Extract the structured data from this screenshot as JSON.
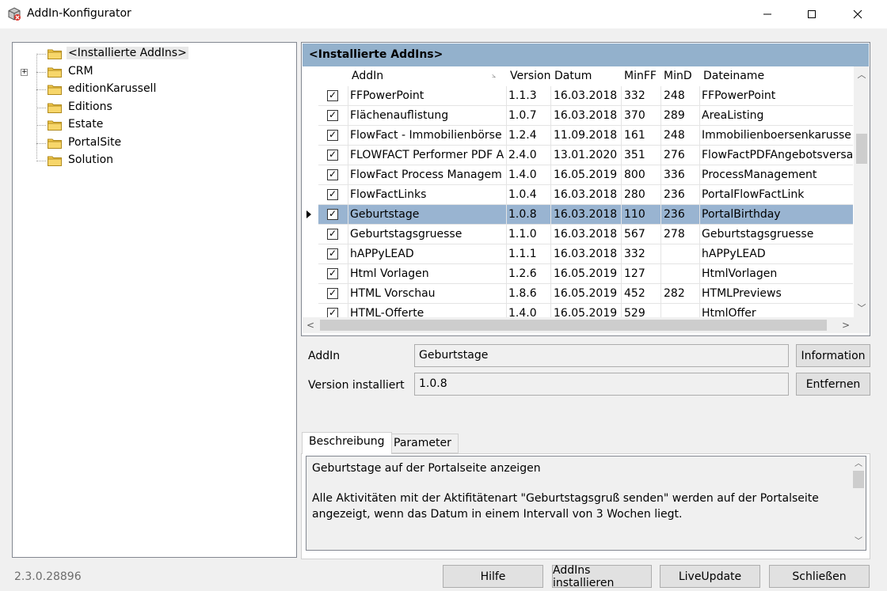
{
  "window": {
    "title": "AddIn-Konfigurator",
    "minimize_glyph": "—",
    "maximize_glyph": "☐",
    "close_glyph": "✕"
  },
  "tree": {
    "items": [
      {
        "label": "<Installierte AddIns>",
        "selected": true,
        "expandable": false
      },
      {
        "label": "CRM",
        "selected": false,
        "expandable": true
      },
      {
        "label": "editionKarussell",
        "selected": false,
        "expandable": false
      },
      {
        "label": "Editions",
        "selected": false,
        "expandable": false
      },
      {
        "label": "Estate",
        "selected": false,
        "expandable": false
      },
      {
        "label": "PortalSite",
        "selected": false,
        "expandable": false
      },
      {
        "label": "Solution",
        "selected": false,
        "expandable": false
      }
    ]
  },
  "grid": {
    "caption": "<Installierte AddIns>",
    "columns": {
      "addin": "AddIn",
      "version": "Version",
      "datum": "Datum",
      "minff": "MinFF",
      "mind": "MinD",
      "dateiname": "Dateiname"
    },
    "rows": [
      {
        "checked": true,
        "addin": "FFPowerPoint",
        "version": "1.1.3",
        "datum": "16.03.2018",
        "minff": "332",
        "mind": "248",
        "dateiname": "FFPowerPoint",
        "selected": false
      },
      {
        "checked": true,
        "addin": "Flächenauflistung",
        "version": "1.0.7",
        "datum": "16.03.2018",
        "minff": "370",
        "mind": "289",
        "dateiname": "AreaListing",
        "selected": false
      },
      {
        "checked": true,
        "addin": "FlowFact - Immobilienbörse",
        "version": "1.2.4",
        "datum": "11.09.2018",
        "minff": "161",
        "mind": "248",
        "dateiname": "Immobilienboersenkarussell",
        "selected": false
      },
      {
        "checked": true,
        "addin": "FLOWFACT Performer PDF A",
        "version": "2.4.0",
        "datum": "13.01.2020",
        "minff": "351",
        "mind": "276",
        "dateiname": "FlowFactPDFAngebotsversa",
        "selected": false
      },
      {
        "checked": true,
        "addin": "FlowFact Process Managem",
        "version": "1.4.0",
        "datum": "16.05.2019",
        "minff": "800",
        "mind": "336",
        "dateiname": "ProcessManagement",
        "selected": false
      },
      {
        "checked": true,
        "addin": "FlowFactLinks",
        "version": "1.0.4",
        "datum": "16.03.2018",
        "minff": "280",
        "mind": "236",
        "dateiname": "PortalFlowFactLink",
        "selected": false
      },
      {
        "checked": true,
        "addin": "Geburtstage",
        "version": "1.0.8",
        "datum": "16.03.2018",
        "minff": "110",
        "mind": "236",
        "dateiname": "PortalBirthday",
        "selected": true
      },
      {
        "checked": true,
        "addin": "Geburtstagsgruesse",
        "version": "1.1.0",
        "datum": "16.03.2018",
        "minff": "567",
        "mind": "278",
        "dateiname": "Geburtstagsgruesse",
        "selected": false
      },
      {
        "checked": true,
        "addin": "hAPPyLEAD",
        "version": "1.1.1",
        "datum": "16.03.2018",
        "minff": "332",
        "mind": "",
        "dateiname": "hAPPyLEAD",
        "selected": false
      },
      {
        "checked": true,
        "addin": "Html Vorlagen",
        "version": "1.2.6",
        "datum": "16.05.2019",
        "minff": "127",
        "mind": "",
        "dateiname": "HtmlVorlagen",
        "selected": false
      },
      {
        "checked": true,
        "addin": "HTML Vorschau",
        "version": "1.8.6",
        "datum": "16.05.2019",
        "minff": "452",
        "mind": "282",
        "dateiname": "HTMLPreviews",
        "selected": false
      },
      {
        "checked": true,
        "addin": "HTML-Offerte",
        "version": "1.4.0",
        "datum": "16.05.2019",
        "minff": "529",
        "mind": "",
        "dateiname": "HtmlOffer",
        "selected": false
      }
    ],
    "check_glyph": "✓",
    "scroll_up": "︿",
    "scroll_down": "﹀",
    "scroll_left": "<",
    "scroll_right": ">"
  },
  "form": {
    "addin_label": "AddIn",
    "addin_value": "Geburtstage",
    "version_label": "Version installiert",
    "version_value": "1.0.8",
    "information_button": "Information",
    "entfernen_button": "Entfernen"
  },
  "tabs": {
    "beschreibung": "Beschreibung",
    "parameter": "Parameter",
    "active": "beschreibung"
  },
  "description": {
    "line1": "Geburtstage auf der Portalseite anzeigen",
    "line2": "Alle Aktivitäten mit der Aktifitätenart \"Geburtstagsgruß senden\" werden auf der Portalseite angezeigt, wenn das Datum in einem Intervall von 3 Wochen liegt."
  },
  "footer": {
    "version": "2.3.0.28896",
    "hilfe_button": "Hilfe",
    "install_button": "AddIns installieren",
    "liveupdate_button": "LiveUpdate",
    "schliessen_button": "Schließen"
  },
  "colors": {
    "caption_bg": "#93b1cc",
    "selected_row_bg": "#99b4d1",
    "folder_yellow": "#f3c94a"
  }
}
